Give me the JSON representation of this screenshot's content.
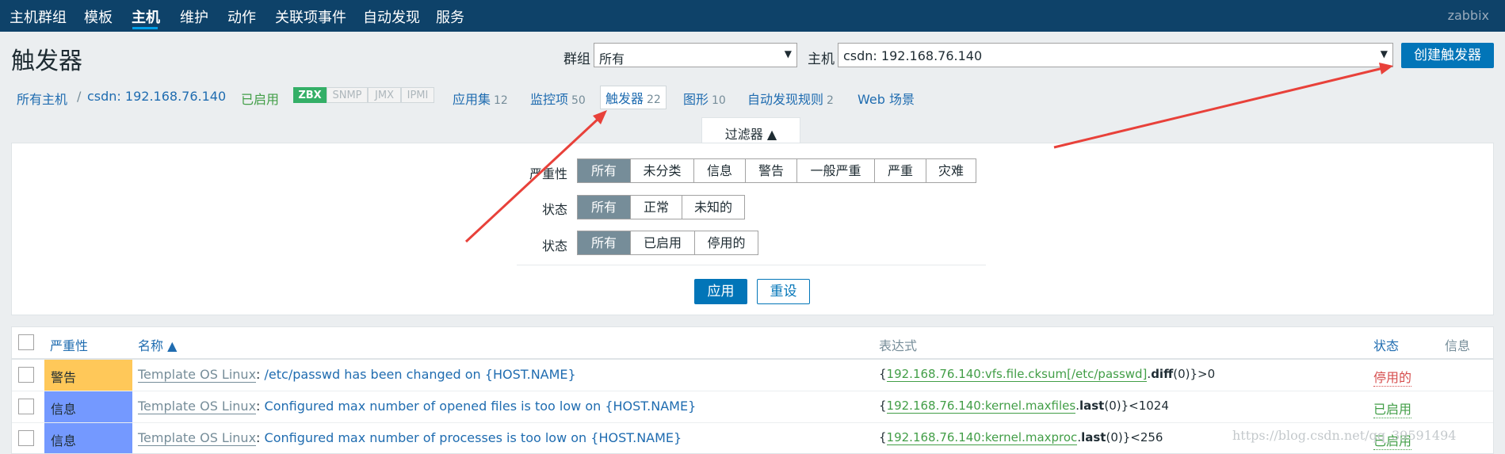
{
  "topnav": {
    "items": [
      "主机群组",
      "模板",
      "主机",
      "维护",
      "动作",
      "关联项事件",
      "自动发现",
      "服务"
    ],
    "brand": "zabbix"
  },
  "header": {
    "title": "触发器",
    "group_label": "群组",
    "group_value": "所有",
    "host_label": "主机",
    "host_value": "csdn: 192.168.76.140",
    "create_button": "创建触发器"
  },
  "hostnav": {
    "all_hosts": "所有主机",
    "separator": "/",
    "host": "csdn: 192.168.76.140",
    "status": "已启用",
    "tags": [
      "ZBX",
      "SNMP",
      "JMX",
      "IPMI"
    ],
    "links": [
      {
        "label": "应用集",
        "count": "12"
      },
      {
        "label": "监控项",
        "count": "50"
      },
      {
        "label": "触发器",
        "count": "22"
      },
      {
        "label": "图形",
        "count": "10"
      },
      {
        "label": "自动发现规则",
        "count": "2"
      },
      {
        "label": "Web 场景",
        "count": ""
      }
    ]
  },
  "filter": {
    "tab_label": "过滤器 ▲",
    "severity_label": "严重性",
    "severity_options": [
      "所有",
      "未分类",
      "信息",
      "警告",
      "一般严重",
      "严重",
      "灾难"
    ],
    "state_label": "状态",
    "state_options": [
      "所有",
      "正常",
      "未知的"
    ],
    "status_label": "状态",
    "status_options": [
      "所有",
      "已启用",
      "停用的"
    ],
    "apply_button": "应用",
    "reset_button": "重设"
  },
  "table": {
    "headers": {
      "severity": "严重性",
      "name": "名称 ▲",
      "expression": "表达式",
      "status": "状态",
      "info": "信息"
    },
    "rows": [
      {
        "severity": "警告",
        "template": "Template OS Linux",
        "name": "/etc/passwd has been changed on {HOST.NAME}",
        "expr_open": "{",
        "expr_host": "192.168.76.140:vfs.file.cksum[/etc/passwd]",
        "expr_dot": ".",
        "expr_fn": "diff",
        "expr_rest": "(0)}>0",
        "status": "停用的"
      },
      {
        "severity": "信息",
        "template": "Template OS Linux",
        "name": "Configured max number of opened files is too low on {HOST.NAME}",
        "expr_open": "{",
        "expr_host": "192.168.76.140:kernel.maxfiles",
        "expr_dot": ".",
        "expr_fn": "last",
        "expr_rest": "(0)}<1024",
        "status": "已启用"
      },
      {
        "severity": "信息",
        "template": "Template OS Linux",
        "name": "Configured max number of processes is too low on {HOST.NAME}",
        "expr_open": "{",
        "expr_host": "192.168.76.140:kernel.maxproc",
        "expr_dot": ".",
        "expr_fn": "last",
        "expr_rest": "(0)}<256",
        "status": "已启用"
      }
    ]
  },
  "watermark": "https://blog.csdn.net/qq_39591494",
  "colors": {
    "nav_bg": "#0e4269",
    "accent": "#0275b8",
    "warning": "#ffc859",
    "information": "#7499ff",
    "enabled": "#429e47",
    "disabled": "#d64e4e",
    "annotation_arrow": "#e8413a"
  }
}
